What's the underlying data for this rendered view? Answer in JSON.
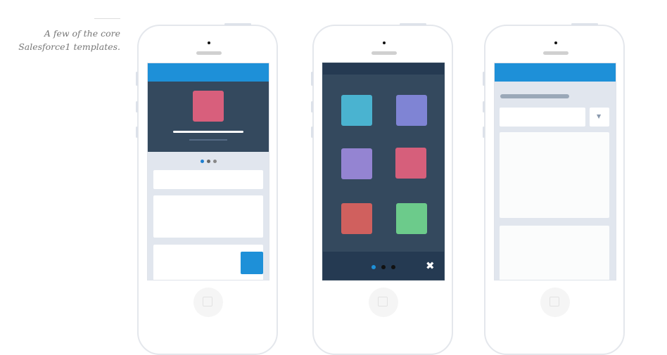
{
  "caption": {
    "line1": "A few of the core",
    "line2": "Salesforce1 templates."
  },
  "colors": {
    "blue": "#1e90d8",
    "dark": "#34495e",
    "darker": "#253a52",
    "gray_bg": "#e1e6ee",
    "pink": "#d85f7c"
  },
  "phones": [
    {
      "template": "record-detail",
      "carousel_dots": 3,
      "active_dot": 1
    },
    {
      "template": "app-launcher",
      "tiles": [
        "#4ab3d0",
        "#7f84d4",
        "#9484d2",
        "#d65f7b",
        "#d0605e",
        "#6ccb8b"
      ],
      "carousel_dots": 3,
      "active_dot": 1,
      "close_icon": "close-icon"
    },
    {
      "template": "form-list",
      "dropdown_icon": "chevron-down-icon"
    }
  ]
}
